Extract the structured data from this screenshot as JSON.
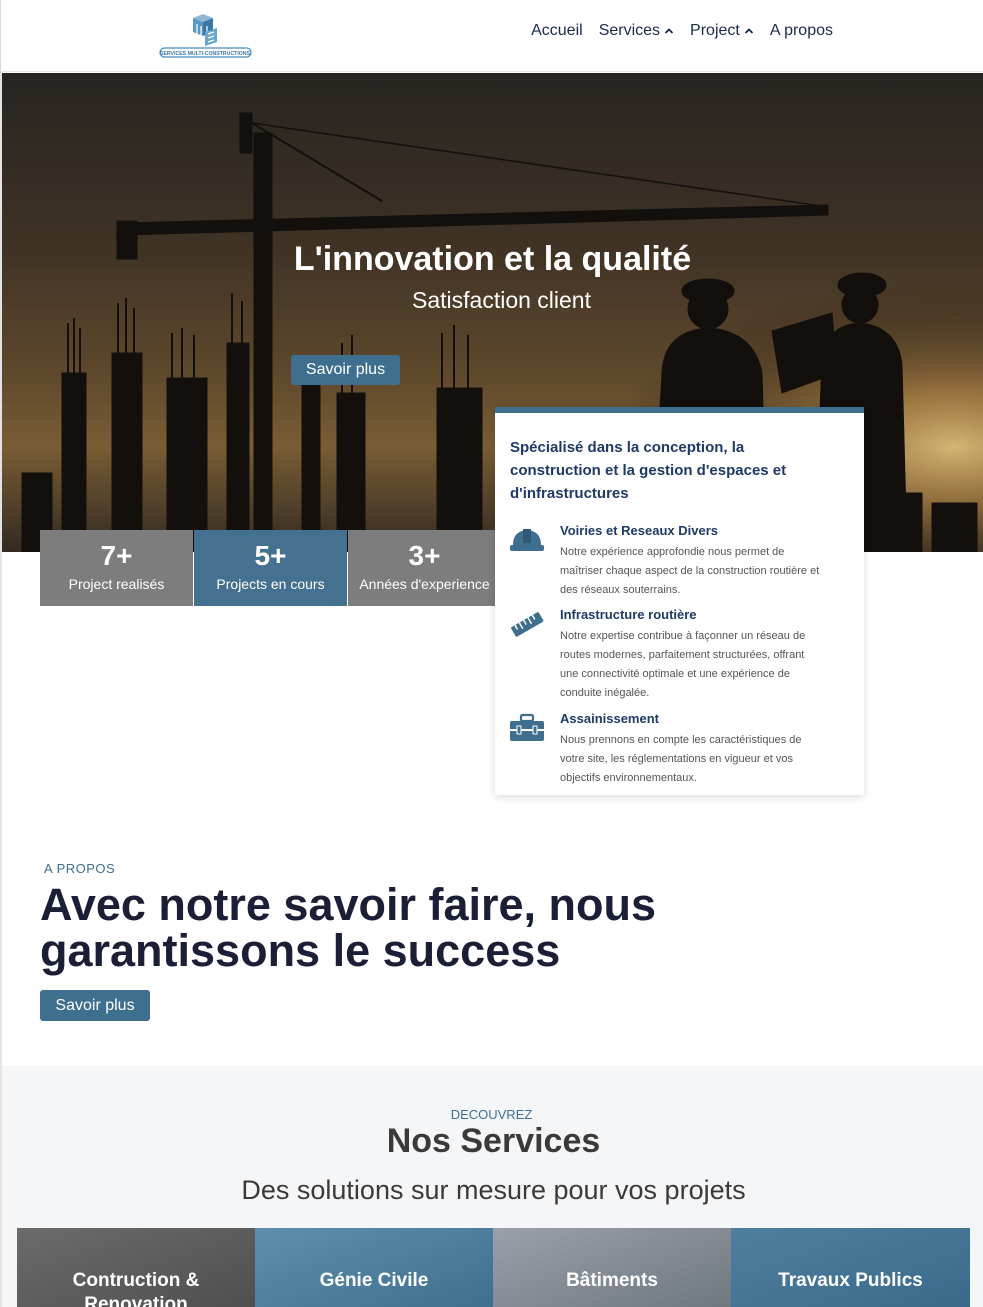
{
  "nav": {
    "logo_caption": "SERVICES MULTI-CONSTRUCTIONS",
    "items": [
      {
        "label": "Accueil",
        "has_dropdown": false
      },
      {
        "label": "Services",
        "has_dropdown": true
      },
      {
        "label": "Project",
        "has_dropdown": true
      },
      {
        "label": "A propos",
        "has_dropdown": false
      }
    ]
  },
  "hero": {
    "title": "L'innovation et la qualité",
    "subtitle": "Satisfaction client",
    "button": "Savoir plus"
  },
  "stats": [
    {
      "value": "7+",
      "label": "Project realisés"
    },
    {
      "value": "5+",
      "label": "Projects en cours"
    },
    {
      "value": "3+",
      "label": "Années d'experience"
    }
  ],
  "card": {
    "title": "Spécialisé dans la conception, la construction et la gestion d'espaces et d'infrastructures",
    "services": [
      {
        "name": "Voiries et Reseaux Divers",
        "icon": "hard-hat-icon",
        "description": "Notre expérience approfondie nous permet de maîtriser chaque aspect de la construction routière et des réseaux souterrains."
      },
      {
        "name": "Infrastructure routière",
        "icon": "ruler-icon",
        "description": "Notre expertise contribue à façonner un réseau de routes modernes, parfaitement structurées, offrant une connectivité optimale et une expérience de conduite inégalée."
      },
      {
        "name": "Assainissement",
        "icon": "toolbox-icon",
        "description": "Nous prennons en compte les caractéristiques de votre site, les réglementations en vigueur et vos objectifs environnementaux."
      }
    ]
  },
  "about": {
    "eyebrow": "A PROPOS",
    "title": "Avec notre savoir faire, nous garantissons le success",
    "button": "Savoir plus"
  },
  "services_section": {
    "eyebrow": "DECOUVREZ",
    "title": "Nos Services",
    "subtitle": "Des solutions sur mesure pour vos projets",
    "tiles": [
      "Contruction & Renovation",
      "Génie Civile",
      "Bâtiments",
      "Travaux Publics"
    ]
  },
  "colors": {
    "accent": "#3f6f8f",
    "navy": "#1f3a66",
    "stat_gray": "#7d7d7d"
  }
}
